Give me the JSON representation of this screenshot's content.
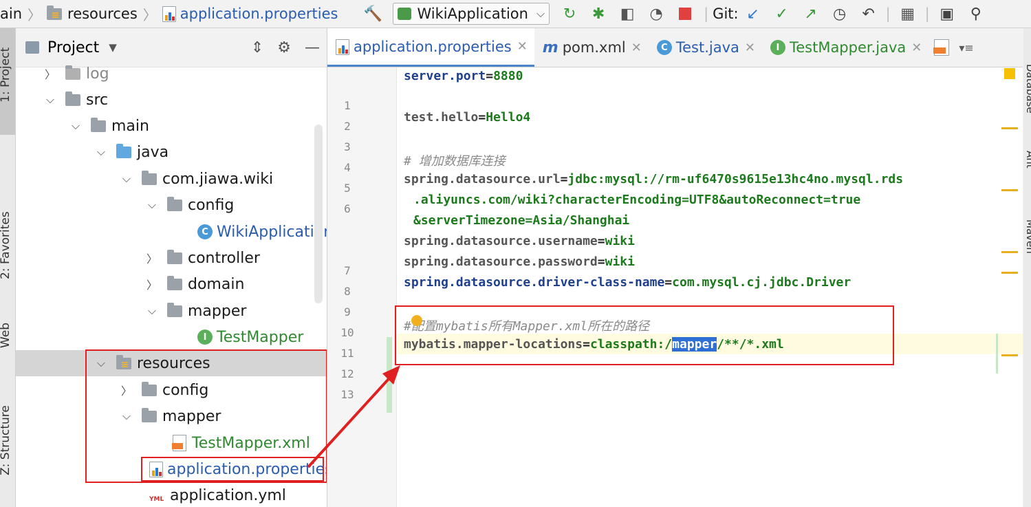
{
  "breadcrumb": {
    "item0": "ain",
    "item1": "resources",
    "item2": "application.properties"
  },
  "toolbar": {
    "run_config": "WikiApplication",
    "git_label": "Git:"
  },
  "left_tabs": {
    "project": "1: Project",
    "favorites": "2: Favorites",
    "web": "Web",
    "structure": "Z: Structure"
  },
  "right_tabs": {
    "database": "Database",
    "ant": "Ant",
    "maven": "Maven"
  },
  "project_panel": {
    "title": "Project",
    "tree": [
      {
        "label": "log"
      },
      {
        "label": "src"
      },
      {
        "label": "main"
      },
      {
        "label": "java"
      },
      {
        "label": "com.jiawa.wiki"
      },
      {
        "label": "config"
      },
      {
        "label": "WikiApplication"
      },
      {
        "label": "controller"
      },
      {
        "label": "domain"
      },
      {
        "label": "mapper"
      },
      {
        "label": "TestMapper"
      },
      {
        "label": "resources"
      },
      {
        "label": "config"
      },
      {
        "label": "mapper"
      },
      {
        "label": "TestMapper.xml"
      },
      {
        "label": "application.properties"
      },
      {
        "label": "application.yml"
      }
    ]
  },
  "tabs": [
    {
      "label": "application.properties"
    },
    {
      "label": "pom.xml"
    },
    {
      "label": "Test.java"
    },
    {
      "label": "TestMapper.java"
    }
  ],
  "editor": {
    "line_numbers": [
      "1",
      "2",
      "3",
      "4",
      "5",
      "6",
      "7",
      "8",
      "9",
      "10",
      "11",
      "12",
      "13"
    ],
    "lines": {
      "l1k": "server.port",
      "l1v": "8880",
      "l3k": "test.hello",
      "l3v": "Hello4",
      "l5c": "# 增加数据库连接",
      "l6k": "spring.datasource.url",
      "l6v": "jdbc:mysql://rm-uf6470s9615e13hc4no.mysql.rds",
      "l6w1": ".aliyuncs.com/wiki?characterEncoding=UTF8&autoReconnect=true",
      "l6w2": "&serverTimezone=Asia/Shanghai",
      "l7k": "spring.datasource.username",
      "l7v": "wiki",
      "l8k": "spring.datasource.password",
      "l8v": "wiki",
      "l9k": "spring.datasource.driver-class-name",
      "l9v": "com.mysql.cj.jdbc.Driver",
      "l11c": "#配置mybatis所有Mapper.xml所在的路径",
      "l12k": "mybatis.mapper-locations",
      "l12v1": "classpath:/",
      "l12sel": "mapper",
      "l12v2": "/**/*.xml"
    },
    "eq": "="
  }
}
